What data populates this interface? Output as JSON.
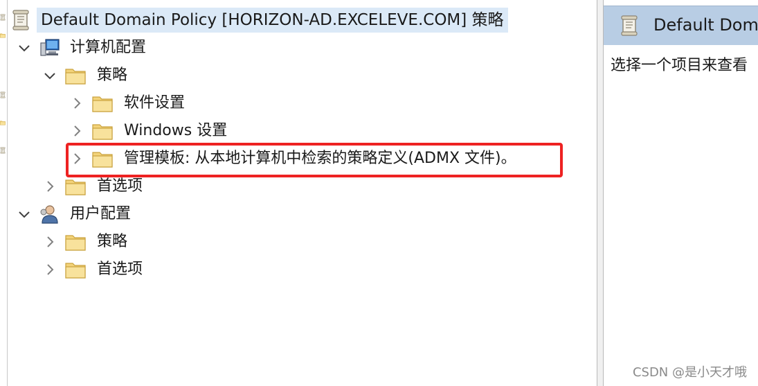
{
  "tree": {
    "root": "Default Domain Policy [HORIZON-AD.EXCELEVE.COM] 策略",
    "computer_config": "计算机配置",
    "computer_policies": "策略",
    "software_settings": "软件设置",
    "windows_settings": "Windows 设置",
    "admin_templates": "管理模板: 从本地计算机中检索的策略定义(ADMX 文件)。",
    "computer_preferences": "首选项",
    "user_config": "用户配置",
    "user_policies": "策略",
    "user_preferences": "首选项"
  },
  "right_pane": {
    "header_title": "Default Doma",
    "body_text": "选择一个项目来查看"
  },
  "watermark": "CSDN @是小天才哦",
  "colors": {
    "highlight_border": "#ee2222",
    "right_header_bg": "#b8cde4",
    "root_selection_bg": "#dbe9f7"
  },
  "icons": {
    "root": "policy-scroll-icon",
    "computer": "computer-icon",
    "user": "user-icon",
    "folder": "folder-icon",
    "expanded": "chevron-down-icon",
    "collapsed": "chevron-right-icon"
  }
}
